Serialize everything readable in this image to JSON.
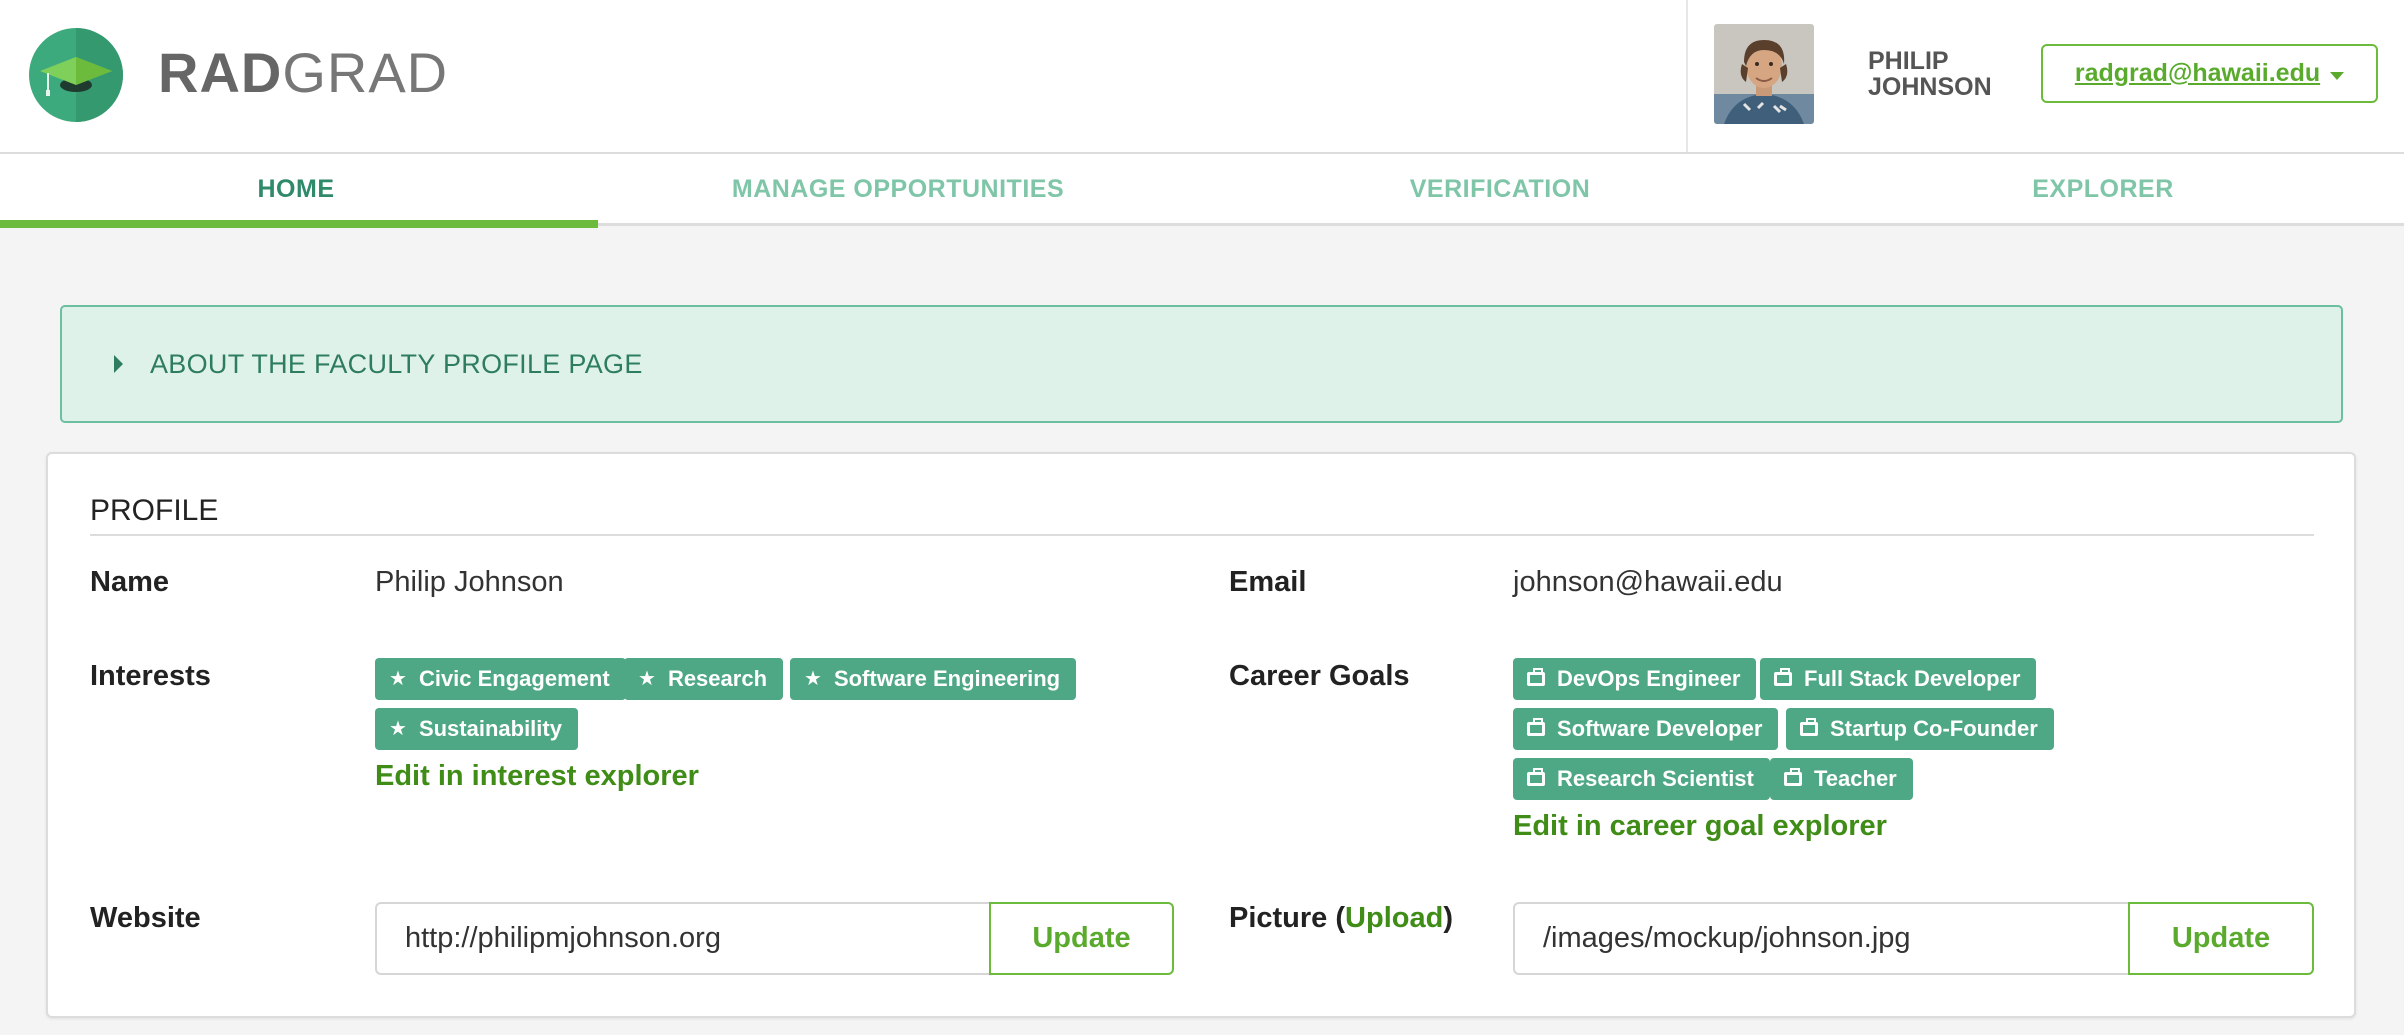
{
  "header": {
    "brand_bold": "RAD",
    "brand_light": "GRAD",
    "user_first": "PHILIP",
    "user_last": "JOHNSON",
    "account_email": "radgrad@hawaii.edu",
    "accent": "#6cbb3c",
    "logo_color": "#3daa7d"
  },
  "nav": {
    "tabs": [
      {
        "label": "HOME",
        "active": true
      },
      {
        "label": "MANAGE OPPORTUNITIES",
        "active": false
      },
      {
        "label": "VERIFICATION",
        "active": false
      },
      {
        "label": "EXPLORER",
        "active": false
      }
    ]
  },
  "banner": {
    "text": "ABOUT THE FACULTY PROFILE PAGE",
    "icon": "caret-right-icon"
  },
  "profile": {
    "title": "PROFILE",
    "name_label": "Name",
    "name_value": "Philip Johnson",
    "email_label": "Email",
    "email_value": "johnson@hawaii.edu",
    "interests_label": "Interests",
    "interests": [
      "Civic Engagement",
      "Research",
      "Software Engineering",
      "Sustainability"
    ],
    "interest_icon": "star-icon",
    "interests_edit": "Edit in interest explorer",
    "career_label": "Career Goals",
    "career_goals": [
      "DevOps Engineer",
      "Full Stack Developer",
      "Software Developer",
      "Startup Co-Founder",
      "Research Scientist",
      "Teacher"
    ],
    "career_icon": "briefcase-icon",
    "career_edit": "Edit in career goal explorer",
    "website_label": "Website",
    "website_value": "http://philipmjohnson.org",
    "website_button": "Update",
    "picture_label": "Picture",
    "picture_upload": "Upload",
    "picture_value": "/images/mockup/johnson.jpg",
    "picture_button": "Update",
    "tag_color": "#4ea885"
  }
}
